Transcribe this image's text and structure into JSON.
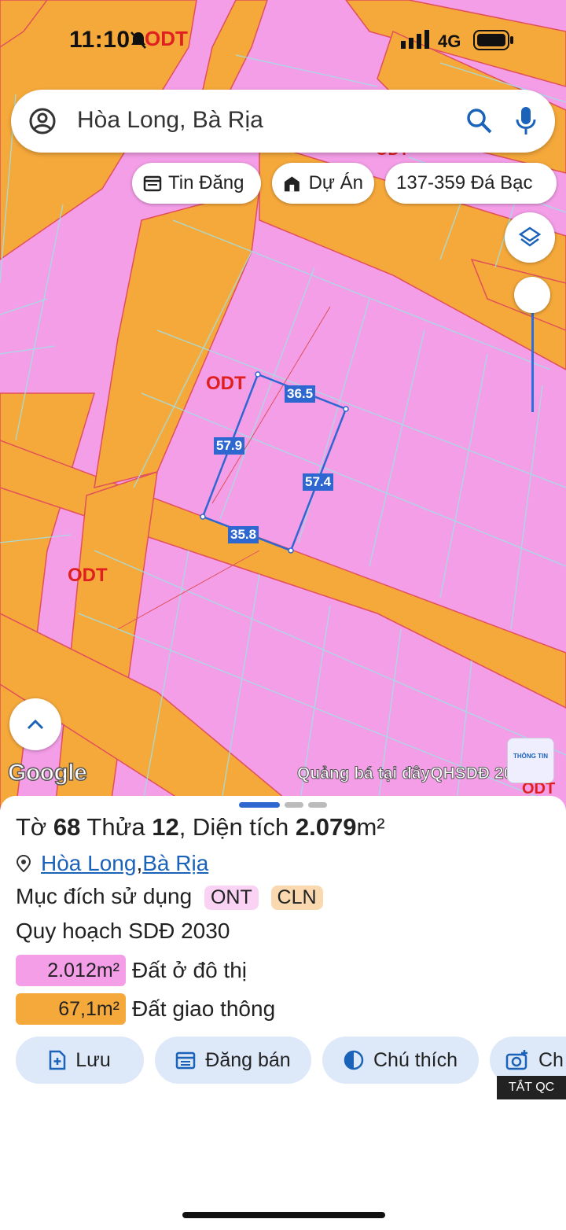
{
  "status": {
    "time": "11:10",
    "network": "4G"
  },
  "search": {
    "query": "Hòa Long, Bà Rịa"
  },
  "chips": [
    {
      "label": "Tin Đăng",
      "icon": "listing-icon"
    },
    {
      "label": "Dự Án",
      "icon": "buildings-icon"
    },
    {
      "label": "137-359 Đá Bạc",
      "icon": ""
    }
  ],
  "map": {
    "zone_labels": [
      "ODT",
      "ODT",
      "ODT",
      "ODT",
      "ODT"
    ],
    "measurements": [
      "36.5",
      "57.9",
      "57.4",
      "35.8"
    ],
    "google_logo": "Google",
    "promo": "Quảng bá tại đây",
    "overlay_name": "QHSDĐ 2030",
    "info_logo": "THÔNG TIN"
  },
  "parcel": {
    "title_prefix": "Tờ ",
    "sheet_no": "68",
    "title_mid": " Thửa ",
    "plot_no": "12",
    "title_area_label": ", Diện tích ",
    "area": "2.079",
    "area_unit": "m²",
    "commune": "Hòa Long",
    "separator": ", ",
    "city": "Bà Rịa",
    "purpose_label": "Mục đích sử dụng",
    "purpose_tags": [
      "ONT",
      "CLN"
    ],
    "plan_label": "Quy hoạch SDĐ 2030",
    "plan_items": [
      {
        "area": "2.012m²",
        "label": "Đất ở đô thị",
        "color": "#f49ee8"
      },
      {
        "area": "67,1m²",
        "label": "Đất giao thông",
        "color": "#f6a93b"
      }
    ]
  },
  "actions": [
    {
      "label": "Lưu",
      "icon": "save-add-icon"
    },
    {
      "label": "Đăng bán",
      "icon": "calendar-icon"
    },
    {
      "label": "Chú thích",
      "icon": "legend-contrast-icon"
    },
    {
      "label": "Ch",
      "icon": "camera-add-icon"
    }
  ],
  "ad_badge": "TẮT QC",
  "colors": {
    "zone_pink": "#f49ee8",
    "road_orange": "#f6a93b",
    "accent_blue": "#2f67d0",
    "button_bg": "#dde8f8"
  }
}
